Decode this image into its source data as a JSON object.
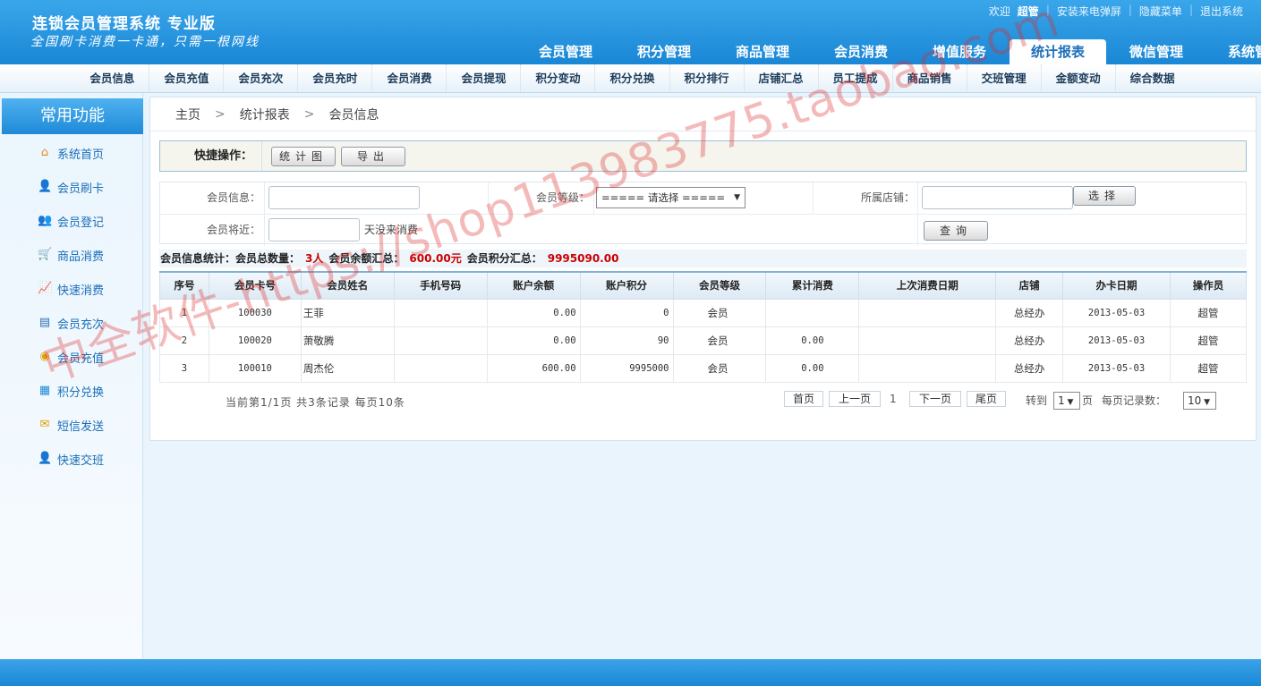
{
  "header": {
    "title": "连锁会员管理系统 专业版",
    "slogan": "全国刷卡消费一卡通，只需一根网线",
    "welcome": "欢迎",
    "user": "超管",
    "links": [
      "安装来电弹屏",
      "隐藏菜单",
      "退出系统"
    ]
  },
  "main_tabs": [
    "会员管理",
    "积分管理",
    "商品管理",
    "会员消费",
    "增值服务",
    "统计报表",
    "微信管理",
    "系统管理"
  ],
  "active_tab": "统计报表",
  "sub_nav": [
    "会员信息",
    "会员充值",
    "会员充次",
    "会员充时",
    "会员消费",
    "会员提现",
    "积分变动",
    "积分兑换",
    "积分排行",
    "店铺汇总",
    "员工提成",
    "商品销售",
    "交班管理",
    "金额变动",
    "综合数据"
  ],
  "sidebar": {
    "title": "常用功能",
    "items": [
      {
        "label": "系统首页",
        "icon": "home-icon"
      },
      {
        "label": "会员刷卡",
        "icon": "user-card-icon"
      },
      {
        "label": "会员登记",
        "icon": "users-icon"
      },
      {
        "label": "商品消费",
        "icon": "cart-icon"
      },
      {
        "label": "快速消费",
        "icon": "chart-icon"
      },
      {
        "label": "会员充次",
        "icon": "register-icon"
      },
      {
        "label": "会员充值",
        "icon": "coin-icon"
      },
      {
        "label": "积分兑换",
        "icon": "grid-icon"
      },
      {
        "label": "短信发送",
        "icon": "mail-icon"
      },
      {
        "label": "快速交班",
        "icon": "shift-icon"
      }
    ]
  },
  "breadcrumb": [
    "主页",
    "统计报表",
    "会员信息"
  ],
  "quick_ops": {
    "label": "快捷操作：",
    "chart_button": "统计图",
    "export_button": "导出"
  },
  "filters": {
    "member_info_label": "会员信息：",
    "member_level_label": "会员等级：",
    "member_level_value": "===== 请选择 =====",
    "store_label": "所属店铺：",
    "select_button": "选择",
    "recent_label": "会员将近：",
    "recent_suffix": "天没来消费",
    "query_button": "查询"
  },
  "stats": {
    "prefix": "会员信息统计：会员总数量：",
    "count": "3人",
    "balance_label": "会员余额汇总：",
    "balance": "600.00元",
    "points_label": "会员积分汇总：",
    "points": "9995090.00"
  },
  "table": {
    "columns": [
      "序号",
      "会员卡号",
      "会员姓名",
      "手机号码",
      "账户余额",
      "账户积分",
      "会员等级",
      "累计消费",
      "上次消费日期",
      "店铺",
      "办卡日期",
      "操作员"
    ],
    "rows": [
      [
        "1",
        "100030",
        "王菲",
        "",
        "0.00",
        "0",
        "会员",
        "",
        "",
        "总经办",
        "2013-05-03",
        "超管"
      ],
      [
        "2",
        "100020",
        "萧敬腾",
        "",
        "0.00",
        "90",
        "会员",
        "0.00",
        "",
        "总经办",
        "2013-05-03",
        "超管"
      ],
      [
        "3",
        "100010",
        "周杰伦",
        "",
        "600.00",
        "9995000",
        "会员",
        "0.00",
        "",
        "总经办",
        "2013-05-03",
        "超管"
      ]
    ]
  },
  "pager": {
    "info": "当前第1/1页 共3条记录 每页10条",
    "first": "首页",
    "prev": "上一页",
    "current": "1",
    "next": "下一页",
    "last": "尾页",
    "goto_label": "转到",
    "goto_value": "1",
    "page_unit": "页",
    "per_page_label": "每页记录数：",
    "per_page_value": "10"
  },
  "watermark": "中全软件-https://shop113983775.taobao.com"
}
